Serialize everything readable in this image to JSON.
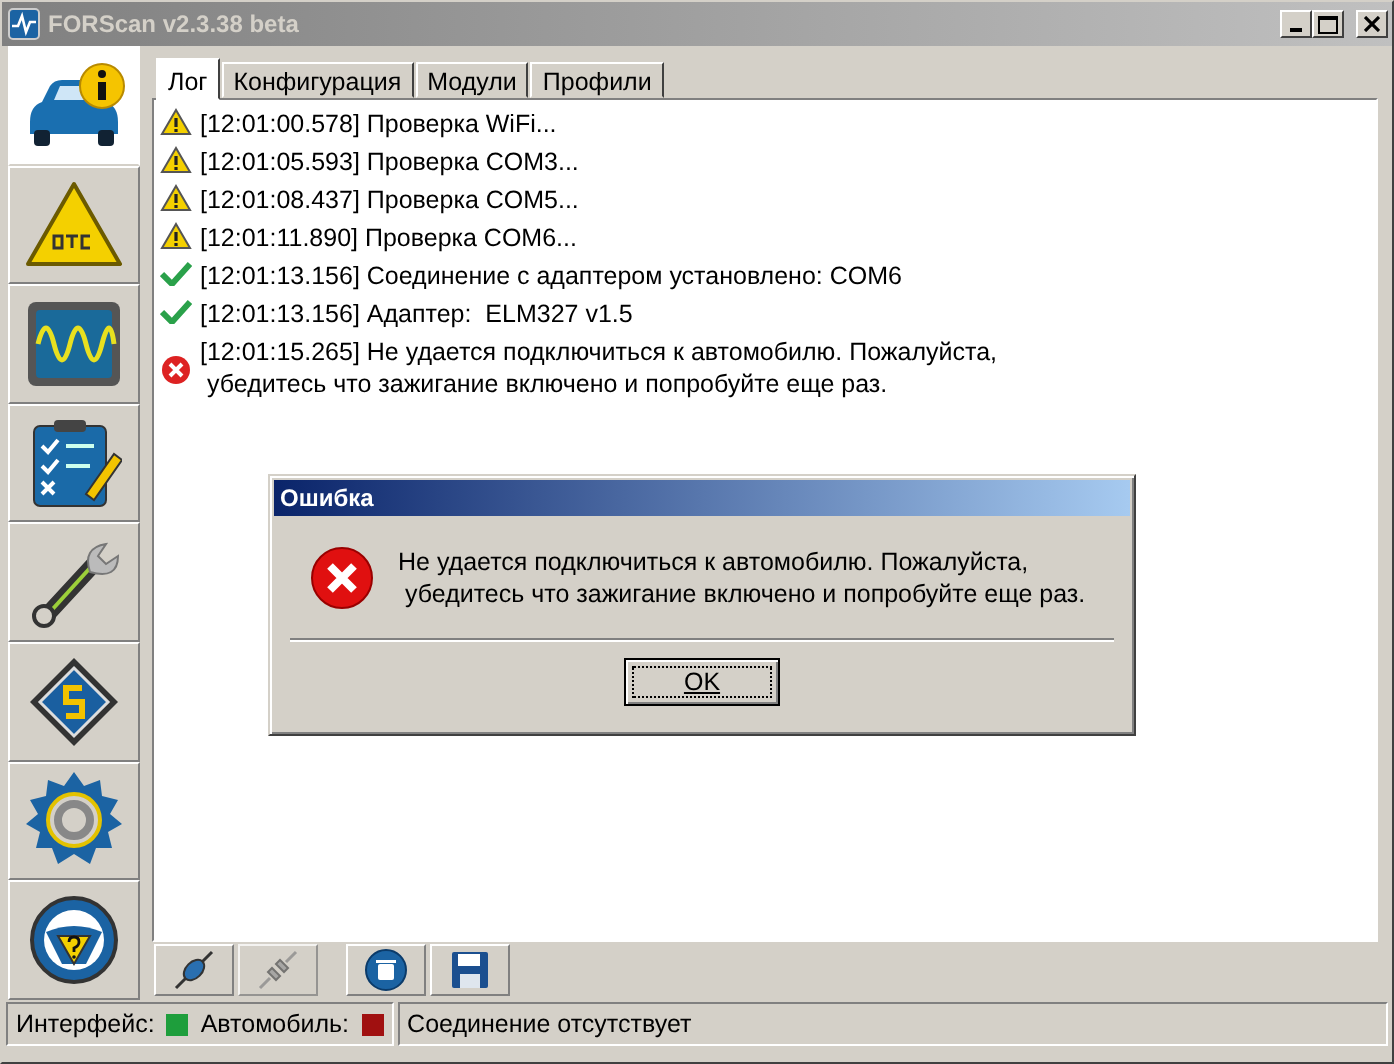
{
  "window": {
    "title": "FORScan v2.3.38 beta"
  },
  "sidebar": {
    "items": [
      {
        "kind": "info",
        "selected": true
      },
      {
        "kind": "dtc",
        "selected": false
      },
      {
        "kind": "oscilloscope",
        "selected": false
      },
      {
        "kind": "checklist",
        "selected": false
      },
      {
        "kind": "wrench",
        "selected": false
      },
      {
        "kind": "chip",
        "selected": false
      },
      {
        "kind": "settings",
        "selected": false
      },
      {
        "kind": "help",
        "selected": false
      }
    ]
  },
  "tabs": [
    {
      "label": "Лог",
      "selected": true
    },
    {
      "label": "Конфигурация",
      "selected": false
    },
    {
      "label": "Модули",
      "selected": false
    },
    {
      "label": "Профили",
      "selected": false
    }
  ],
  "log": [
    {
      "kind": "warning",
      "text": "[12:01:00.578] Проверка WiFi..."
    },
    {
      "kind": "warning",
      "text": "[12:01:05.593] Проверка COM3..."
    },
    {
      "kind": "warning",
      "text": "[12:01:08.437] Проверка COM5..."
    },
    {
      "kind": "warning",
      "text": "[12:01:11.890] Проверка COM6..."
    },
    {
      "kind": "success",
      "text": "[12:01:13.156] Соединение с адаптером установлено: COM6"
    },
    {
      "kind": "success",
      "text": "[12:01:13.156] Адаптер:  ELM327 v1.5"
    },
    {
      "kind": "error",
      "text": "[12:01:15.265] Не удается подключиться к автомобилю. Пожалуйста,\n убедитесь что зажигание включено и попробуйте еще раз."
    }
  ],
  "toolbar": [
    {
      "kind": "connect",
      "disabled": false
    },
    {
      "kind": "disconnect",
      "disabled": true
    },
    {
      "kind": "clear",
      "disabled": false
    },
    {
      "kind": "save",
      "disabled": false
    }
  ],
  "status_bar": {
    "indicators": [
      {
        "label": "Интерфейс:",
        "color": "#1e9e3c"
      },
      {
        "label": "Автомобиль:",
        "color": "#a01010"
      }
    ],
    "message": "Соединение отсутствует"
  },
  "dialog": {
    "title": "Ошибка",
    "message": "Не удается подключиться к автомобилю. Пожалуйста,\n убедитесь что зажигание включено и попробуйте еще раз.",
    "button": "OK"
  }
}
